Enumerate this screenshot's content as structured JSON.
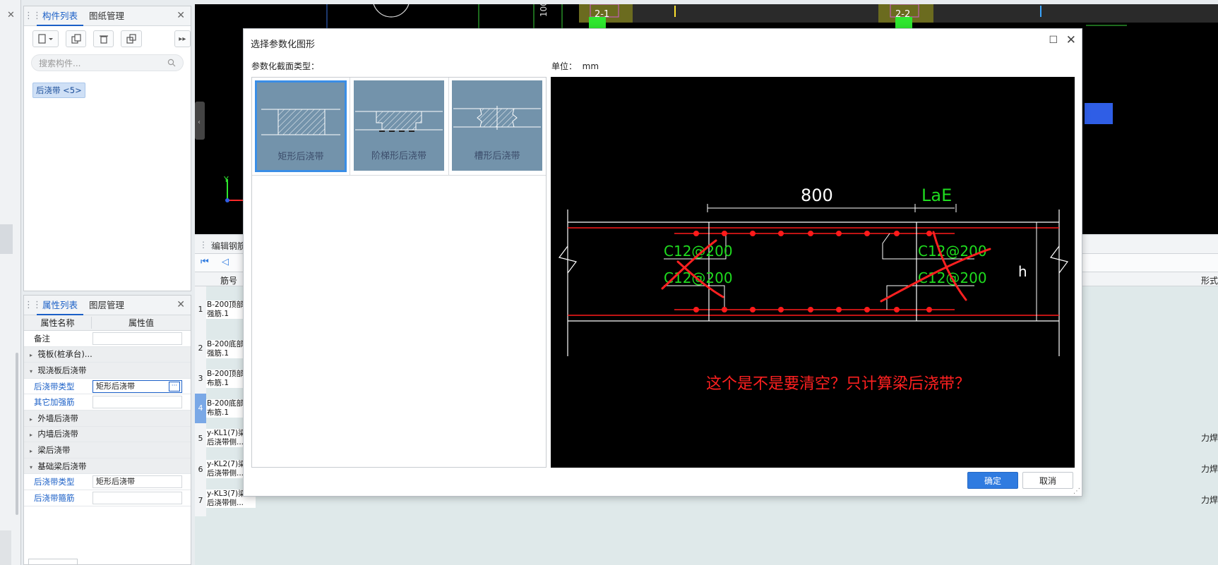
{
  "left_panel_top": {
    "tabs": [
      "构件列表",
      "图纸管理"
    ],
    "search_placeholder": "搜索构件...",
    "tag": "后浇带 <5>"
  },
  "props_panel": {
    "tabs": [
      "属性列表",
      "图层管理"
    ],
    "col_name": "属性名称",
    "col_value": "属性值",
    "rows": [
      {
        "name": "备注",
        "value": ""
      },
      {
        "name": "筏板(桩承台)...",
        "group": true,
        "expanded": false
      },
      {
        "name": "现浇板后浇带",
        "group": true,
        "expanded": true
      },
      {
        "name": "后浇带类型",
        "value": "矩形后浇带",
        "blue": true
      },
      {
        "name": "其它加强筋",
        "value": "",
        "blue": true
      },
      {
        "name": "外墙后浇带",
        "group": true,
        "expanded": false
      },
      {
        "name": "内墙后浇带",
        "group": true,
        "expanded": false
      },
      {
        "name": "梁后浇带",
        "group": true,
        "expanded": false
      },
      {
        "name": "基础梁后浇带",
        "group": true,
        "expanded": true
      },
      {
        "name": "后浇带类型",
        "value": "矩形后浇带",
        "blue": true
      },
      {
        "name": "后浇带箍筋",
        "value": "",
        "blue": true
      }
    ]
  },
  "cad_bg": {
    "label_1": "2-1",
    "label_2": "2-2",
    "label_100": "100",
    "axis_y": "Y"
  },
  "bottom_table": {
    "title": "编辑钢筋",
    "col_header": "筋号",
    "right_header": "形式",
    "rows": [
      {
        "num": "1",
        "text": "B-200顶部:\n强筋.1"
      },
      {
        "num": "2",
        "text": "B-200底部:\n强筋.1"
      },
      {
        "num": "3",
        "text": "B-200顶部:\n布筋.1"
      },
      {
        "num": "4",
        "text": "B-200底部:\n布筋.1"
      },
      {
        "num": "5",
        "text": "y-KL1(7)梁\n后浇带侧..."
      },
      {
        "num": "6",
        "text": "y-KL2(7)梁\n后浇带侧..."
      },
      {
        "num": "7",
        "text": "y-KL3(7)梁\n后浇带侧..."
      }
    ],
    "right_cells": [
      "力焊",
      "力焊",
      "力焊"
    ]
  },
  "dialog": {
    "title": "选择参数化图形",
    "section_label": "参数化截面类型：",
    "unit_label": "单位：",
    "unit_value": "mm",
    "thumbnails": [
      "矩形后浇带",
      "阶梯形后浇带",
      "槽形后浇带"
    ],
    "selected_index": 0,
    "ok": "确定",
    "cancel": "取消"
  },
  "preview": {
    "dim_800": "800",
    "dim_lae": "LaE",
    "dim_h": "h",
    "rebar_labels": [
      "C12@200",
      "C12@200",
      "C12@200",
      "C12@200"
    ],
    "annotation": "这个是不是要清空？只计算梁后浇带？"
  },
  "colors": {
    "accent": "#1a5fc7",
    "ok_button": "#2f7be0",
    "thumb_bg": "#7393ab",
    "rebar_red": "#ff1a1a",
    "label_green": "#1fdc1f",
    "annotation_red": "#ff2020"
  }
}
